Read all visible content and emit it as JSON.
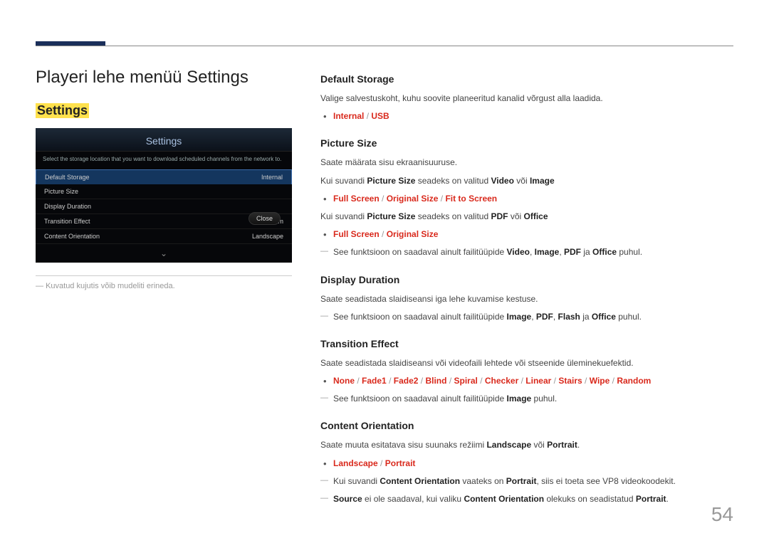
{
  "page": {
    "title": "Playeri lehe menüü Settings",
    "highlightedSection": "Settings",
    "footnote": "Kuvatud kujutis võib mudeliti erineda.",
    "pageNumber": "54"
  },
  "deviceMock": {
    "title": "Settings",
    "subtitle": "Select the storage location that you want to download scheduled channels from the network to.",
    "close": "Close",
    "rows": [
      {
        "label": "Default Storage",
        "value": "Internal",
        "selected": true
      },
      {
        "label": "Picture Size",
        "value": "",
        "selected": false
      },
      {
        "label": "Display Duration",
        "value": "",
        "selected": false
      },
      {
        "label": "Transition Effect",
        "value": "Random",
        "selected": false
      },
      {
        "label": "Content Orientation",
        "value": "Landscape",
        "selected": false
      }
    ]
  },
  "defaultStorage": {
    "heading": "Default Storage",
    "desc": "Valige salvestuskoht, kuhu soovite planeeritud kanalid võrgust alla laadida.",
    "opt1": "Internal",
    "opt2": "USB"
  },
  "pictureSize": {
    "heading": "Picture Size",
    "desc1": "Saate määrata sisu ekraanisuuruse.",
    "desc2_pre": "Kui suvandi ",
    "desc2_bold1": "Picture Size",
    "desc2_mid": " seadeks on valitud ",
    "desc2_bold2": "Video",
    "desc2_or": " või ",
    "desc2_bold3": "Image",
    "opts_a": {
      "o1": "Full Screen",
      "o2": "Original Size",
      "o3": "Fit to Screen"
    },
    "desc3_pre": "Kui suvandi ",
    "desc3_bold1": "Picture Size",
    "desc3_mid": " seadeks on valitud ",
    "desc3_bold2": "PDF",
    "desc3_or": " või ",
    "desc3_bold3": "Office",
    "opts_b": {
      "o1": "Full Screen",
      "o2": "Original Size"
    },
    "note_pre": "See funktsioon on saadaval ainult failitüüpide ",
    "note_b1": "Video",
    "note_b2": "Image",
    "note_b3": "PDF",
    "note_and": " ja ",
    "note_b4": "Office",
    "note_suf": " puhul."
  },
  "displayDuration": {
    "heading": "Display Duration",
    "desc": "Saate seadistada slaidiseansi iga lehe kuvamise kestuse.",
    "note_pre": "See funktsioon on saadaval ainult failitüüpide ",
    "nb1": "Image",
    "nb2": "PDF",
    "nb3": "Flash",
    "nand": " ja ",
    "nb4": "Office",
    "note_suf": " puhul."
  },
  "transitionEffect": {
    "heading": "Transition Effect",
    "desc": "Saate seadistada slaidiseansi või videofaili lehtede või stseenide üleminekuefektid.",
    "opts": [
      "None",
      "Fade1",
      "Fade2",
      "Blind",
      "Spiral",
      "Checker",
      "Linear",
      "Stairs",
      "Wipe",
      "Random"
    ],
    "note_pre": "See funktsioon on saadaval ainult failitüüpide ",
    "nb1": "Image",
    "note_suf": " puhul."
  },
  "contentOrientation": {
    "heading": "Content Orientation",
    "desc_pre": "Saate muuta esitatava sisu suunaks režiimi ",
    "o1": "Landscape",
    "or": " või ",
    "o2": "Portrait",
    "desc_suf": ".",
    "opt1": "Landscape",
    "opt2": "Portrait",
    "note1_pre": "Kui suvandi ",
    "n1b1": "Content Orientation",
    "n1_mid": " vaateks on ",
    "n1b2": "Portrait",
    "n1_suf": ", siis ei toeta see VP8 videokoodekit.",
    "note2_b1": "Source",
    "n2_mid": " ei ole saadaval, kui valiku ",
    "n2b2": "Content Orientation",
    "n2_mid2": " olekuks on seadistatud ",
    "n2b3": "Portrait",
    "n2_suf": "."
  }
}
